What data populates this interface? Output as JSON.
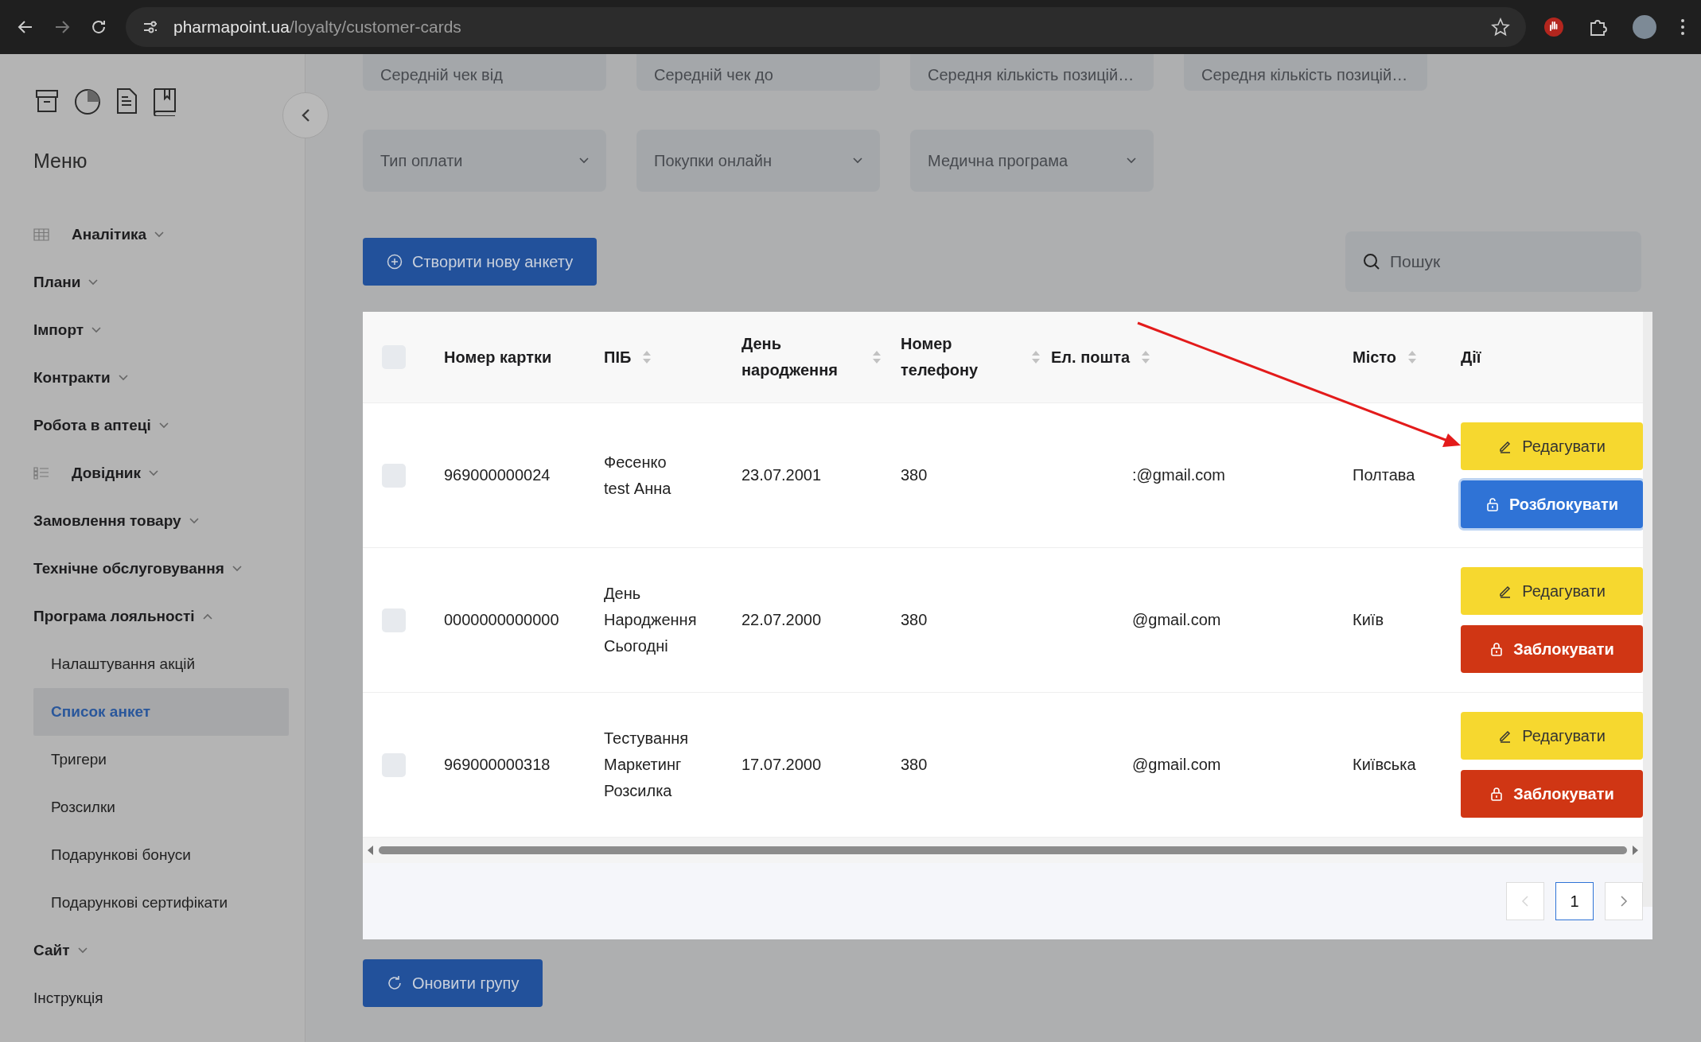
{
  "browser": {
    "url_host": "pharmapoint.ua",
    "url_path": "/loyalty/customer-cards"
  },
  "sidebar": {
    "title": "Меню",
    "items": [
      {
        "label": "Аналітика",
        "expanded": false
      },
      {
        "label": "Плани",
        "expanded": false
      },
      {
        "label": "Імпорт",
        "expanded": false
      },
      {
        "label": "Контракти",
        "expanded": false
      },
      {
        "label": "Робота в аптеці",
        "expanded": false
      },
      {
        "label": "Довідник",
        "expanded": false
      },
      {
        "label": "Замовлення товару",
        "expanded": false
      },
      {
        "label": "Технічне обслуговування",
        "expanded": false
      },
      {
        "label": "Програма лояльності",
        "expanded": true,
        "children": [
          {
            "label": "Налаштування акцій",
            "selected": false
          },
          {
            "label": "Список анкет",
            "selected": true
          },
          {
            "label": "Тригери",
            "selected": false
          },
          {
            "label": "Розсилки",
            "selected": false
          },
          {
            "label": "Подарункові бонуси",
            "selected": false
          },
          {
            "label": "Подарункові сертифікати",
            "selected": false
          }
        ]
      },
      {
        "label": "Сайт",
        "expanded": false
      },
      {
        "label": "Інструкція"
      }
    ]
  },
  "filters": {
    "row_1": [
      {
        "placeholder": "Середній чек від"
      },
      {
        "placeholder": "Середній чек до"
      },
      {
        "placeholder": "Середня кількість позицій…"
      },
      {
        "placeholder": "Середня кількість позицій…"
      }
    ],
    "row_2": [
      {
        "placeholder": "Тип оплати"
      },
      {
        "placeholder": "Покупки онлайн"
      },
      {
        "placeholder": "Медична програма"
      }
    ]
  },
  "create_button": "Створити нову анкету",
  "search": {
    "placeholder": "Пошук"
  },
  "table": {
    "select_all": {
      "checked": false
    },
    "columns": [
      {
        "label": "Номер картки",
        "sortable": false
      },
      {
        "label": "ПІБ",
        "sortable": true
      },
      {
        "label": "День народження",
        "sortable": true
      },
      {
        "label": "Номер телефону",
        "sortable": true
      },
      {
        "label": "Ел. пошта",
        "sortable": true
      },
      {
        "label": "Місто",
        "sortable": true
      },
      {
        "label": "Дії",
        "sortable": false
      }
    ],
    "rows": [
      {
        "checked": false,
        "card": "969000000024",
        "name": "Фесенко test Анна",
        "birthday": "23.07.2001",
        "phone": "380",
        "email": ":@gmail.com",
        "city": "Полтава",
        "actions": [
          {
            "kind": "edit",
            "label": "Редагувати",
            "focused": false
          },
          {
            "kind": "unlock",
            "label": "Розблокувати",
            "focused": true
          }
        ]
      },
      {
        "checked": false,
        "card": "0000000000000",
        "name": "День Народження Сьогодні",
        "birthday": "22.07.2000",
        "phone": "380",
        "email": "@gmail.com",
        "city": "Київ",
        "actions": [
          {
            "kind": "edit",
            "label": "Редагувати",
            "focused": false
          },
          {
            "kind": "lock",
            "label": "Заблокувати",
            "focused": false
          }
        ]
      },
      {
        "checked": false,
        "card": "969000000318",
        "name": "Тестування Маркетинг Розсилка",
        "birthday": "17.07.2000",
        "phone": "380",
        "email": "@gmail.com",
        "city": "Київська",
        "actions": [
          {
            "kind": "edit",
            "label": "Редагувати",
            "focused": false
          },
          {
            "kind": "lock",
            "label": "Заблокувати",
            "focused": false
          }
        ]
      }
    ]
  },
  "pagination": {
    "pages": [
      {
        "label": "1",
        "selected": true
      }
    ],
    "prev_disabled": true,
    "next_disabled": false
  },
  "refresh_button": "Оновити групу"
}
